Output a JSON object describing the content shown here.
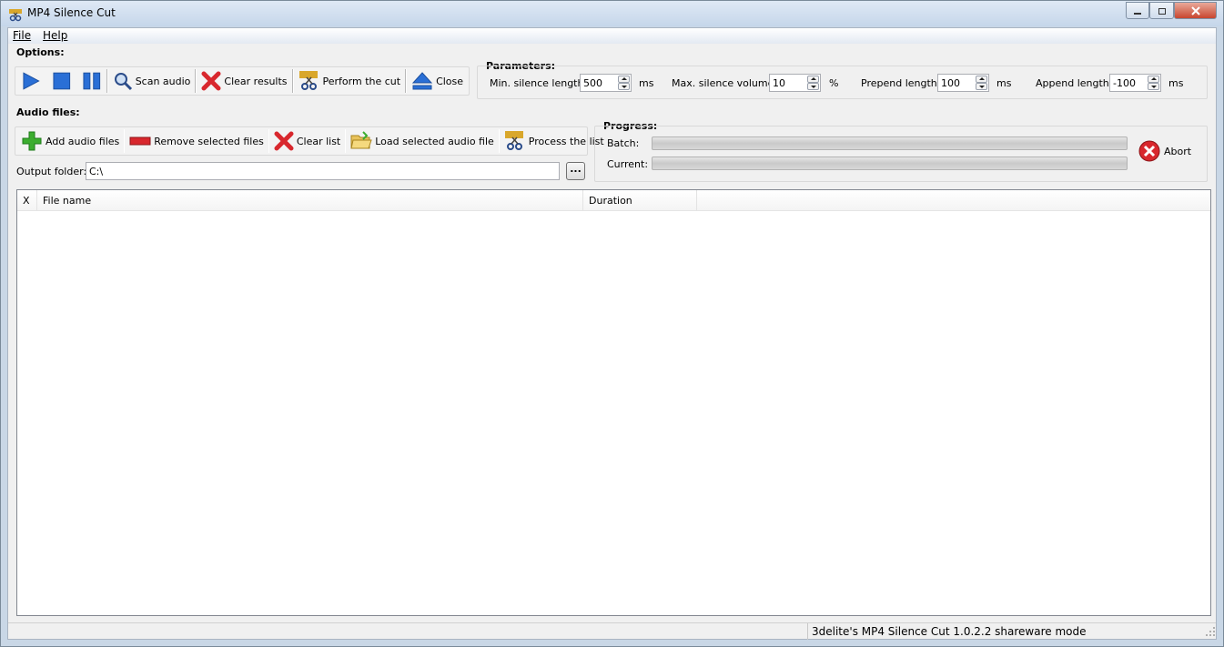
{
  "window": {
    "title": "MP4 Silence Cut"
  },
  "menu": {
    "file": "File",
    "help": "Help"
  },
  "options": {
    "label": "Options:",
    "scan_audio": "Scan audio",
    "clear_results": "Clear results",
    "perform_cut": "Perform the cut",
    "close": "Close"
  },
  "parameters": {
    "label": "Parameters:",
    "min_silence_label": "Min. silence length:",
    "min_silence_value": "500",
    "min_silence_unit": "ms",
    "max_volume_label": "Max. silence volume:",
    "max_volume_value": "10",
    "max_volume_unit": "%",
    "prepend_label": "Prepend length:",
    "prepend_value": "100",
    "prepend_unit": "ms",
    "append_label": "Append length:",
    "append_value": "-100",
    "append_unit": "ms"
  },
  "audio_files": {
    "label": "Audio files:",
    "add": "Add audio files",
    "remove": "Remove selected files",
    "clear": "Clear list",
    "load": "Load selected audio file",
    "process": "Process the list",
    "output_label": "Output folder:",
    "output_value": "C:\\",
    "browse": "..."
  },
  "progress": {
    "label": "Progress:",
    "batch_label": "Batch:",
    "batch_value": 0,
    "current_label": "Current:",
    "current_value": 0,
    "abort": "Abort"
  },
  "table": {
    "columns": [
      "X",
      "File name",
      "Duration"
    ],
    "rows": []
  },
  "status": {
    "text": "3delite's MP4 Silence Cut 1.0.2.2 shareware mode"
  },
  "colors": {
    "accent": "#2a6fd6",
    "close_red": "#d8272d",
    "add_green": "#3cad2f"
  }
}
